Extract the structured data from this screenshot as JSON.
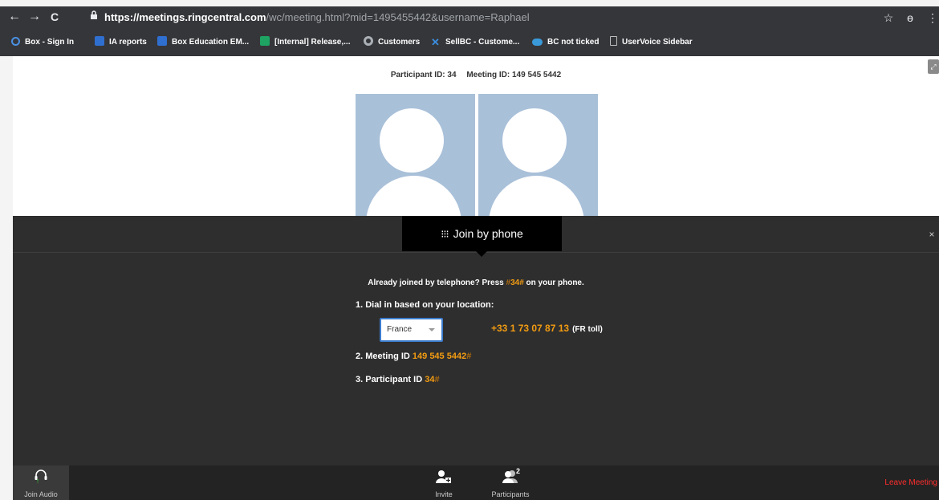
{
  "browser": {
    "url_domain": "https://meetings.ringcentral.com",
    "url_path": "/wc/meeting.html?mid=1495455442&username=Raphael",
    "back_icon": "←",
    "forward_icon": "→",
    "reload_icon": "C",
    "star_icon": "☆",
    "ext_icon": "ɵ",
    "menu_icon": "⋮"
  },
  "bookmarks": [
    {
      "label": "Box - Sign In",
      "icon": "circle-icon",
      "color": "#4a90e2"
    },
    {
      "label": "IA reports",
      "icon": "box-icon",
      "color": "#2f6fd0"
    },
    {
      "label": "Box Education EM...",
      "icon": "box-icon",
      "color": "#2f6fd0"
    },
    {
      "label": "[Internal] Release,...",
      "icon": "sheets-icon",
      "color": "#1ea362"
    },
    {
      "label": "Customers",
      "icon": "ring-icon",
      "color": "#5f6368"
    },
    {
      "label": "SellBC - Custome...",
      "icon": "x-icon",
      "color": "#3b8fe0"
    },
    {
      "label": "BC not ticked",
      "icon": "cloud-icon",
      "color": "#3a9ad9"
    },
    {
      "label": "UserVoice Sidebar",
      "icon": "page-icon",
      "color": "#bdbdbd"
    }
  ],
  "meeting": {
    "participant_id_label": "Participant ID: 34",
    "meeting_id_label": "Meeting ID: 149 545 5442"
  },
  "panel": {
    "tab_label": "Join by phone",
    "close_glyph": "×",
    "already_prefix": "Already joined by telephone? Press ",
    "already_code_hash": "#",
    "already_code": "34",
    "already_code_end": "#",
    "already_suffix": " on your phone.",
    "step1": "1. Dial in based on your location:",
    "country": "France",
    "dial_number": "+33 1 73 07 87 13",
    "dial_note": "(FR toll)",
    "step2_label": "2. Meeting ID",
    "step2_value": "149 545 5442",
    "step2_hash": "#",
    "step3_label": "3. Participant ID",
    "step3_value": "34",
    "step3_hash": "#"
  },
  "bottombar": {
    "join_audio": "Join Audio",
    "invite": "Invite",
    "participants": "Participants",
    "participants_count": "2",
    "leave": "Leave Meeting"
  }
}
